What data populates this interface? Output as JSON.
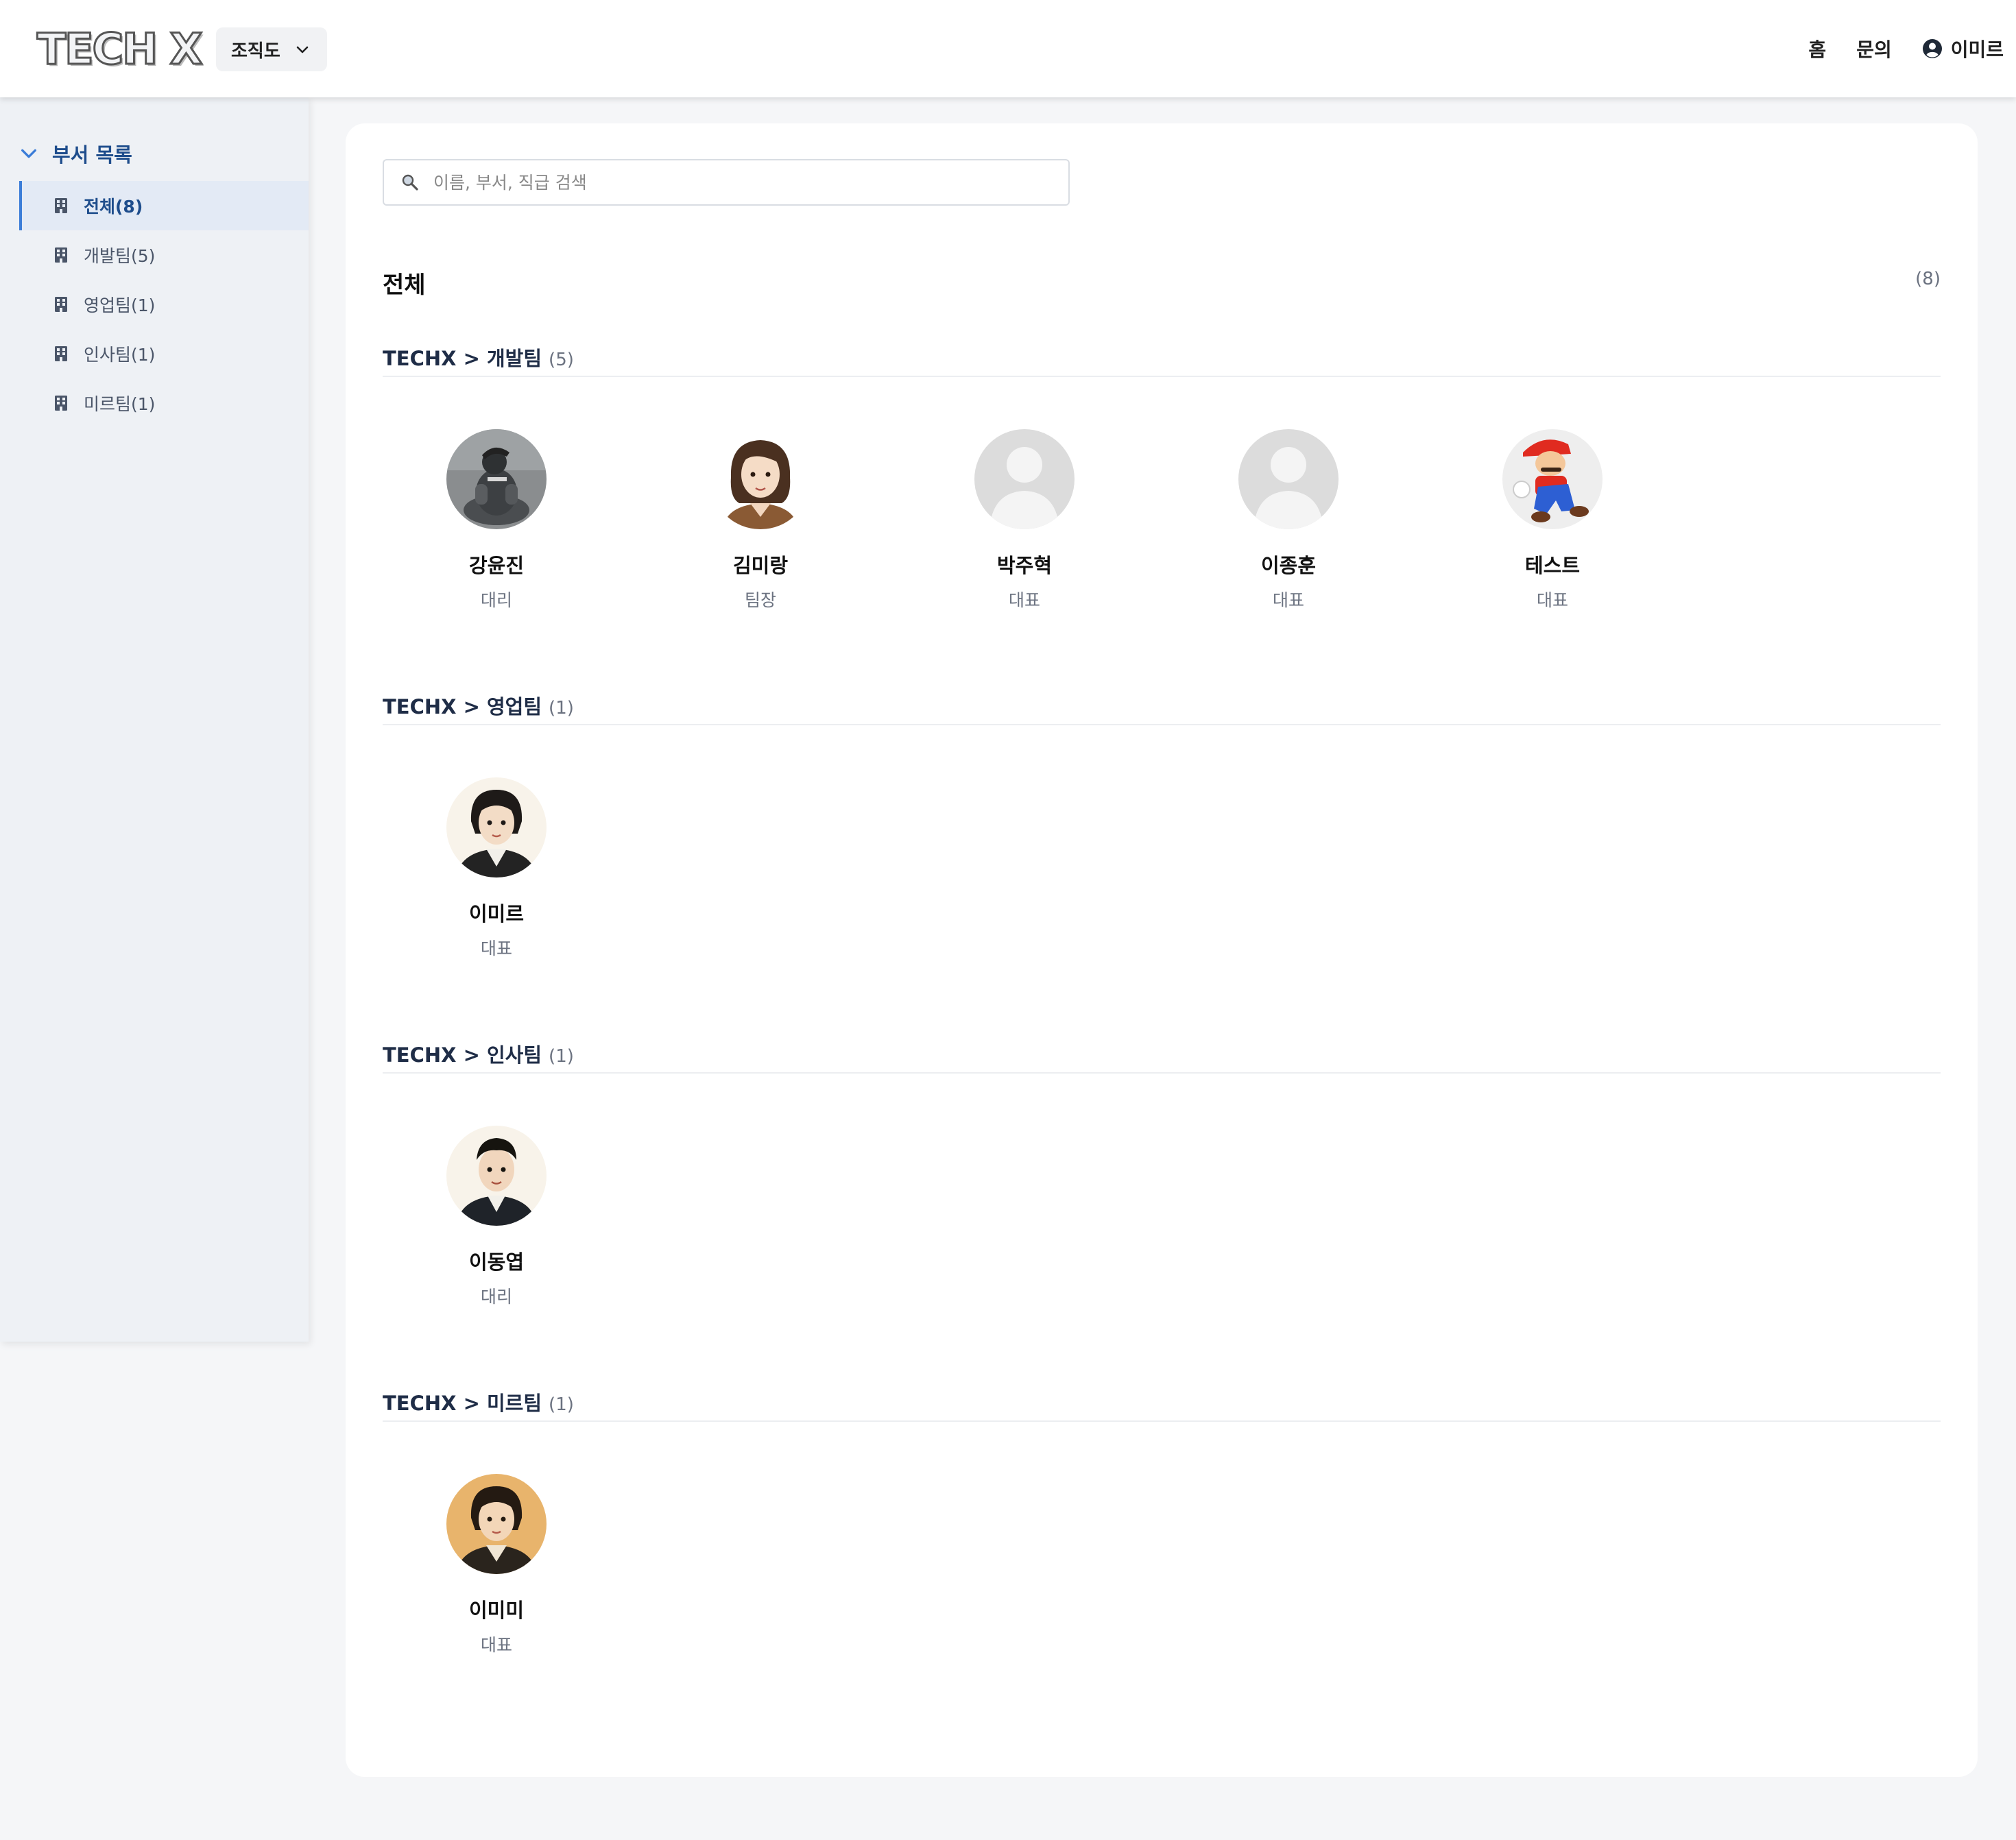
{
  "header": {
    "logo_text": "TECH X",
    "org_select": "조직도",
    "nav": {
      "home": "홈",
      "inquiry": "문의",
      "user": "이미르"
    }
  },
  "sidebar": {
    "title": "부서 목록",
    "items": [
      {
        "label": "전체(8)",
        "active": true
      },
      {
        "label": "개발팀(5)",
        "active": false
      },
      {
        "label": "영업팀(1)",
        "active": false
      },
      {
        "label": "인사팀(1)",
        "active": false
      },
      {
        "label": "미르팀(1)",
        "active": false
      }
    ]
  },
  "main": {
    "search_placeholder": "이름, 부서, 직급 검색",
    "section_title": "전체",
    "section_count": "(8)",
    "groups": [
      {
        "title": "TECHX > 개발팀",
        "count": "(5)",
        "members": [
          {
            "name": "강윤진",
            "role": "대리",
            "avatar": "statue-photo"
          },
          {
            "name": "김미랑",
            "role": "팀장",
            "avatar": "illustrated-woman-short-hair"
          },
          {
            "name": "박주혁",
            "role": "대표",
            "avatar": "default-avatar"
          },
          {
            "name": "이종훈",
            "role": "대표",
            "avatar": "default-avatar"
          },
          {
            "name": "테스트",
            "role": "대표",
            "avatar": "mario-character"
          }
        ]
      },
      {
        "title": "TECHX > 영업팀",
        "count": "(1)",
        "members": [
          {
            "name": "이미르",
            "role": "대표",
            "avatar": "illustrated-woman-bob"
          }
        ]
      },
      {
        "title": "TECHX > 인사팀",
        "count": "(1)",
        "members": [
          {
            "name": "이동엽",
            "role": "대리",
            "avatar": "illustrated-man"
          }
        ]
      },
      {
        "title": "TECHX > 미르팀",
        "count": "(1)",
        "members": [
          {
            "name": "이미미",
            "role": "대표",
            "avatar": "illustrated-woman-warm-bg"
          }
        ]
      }
    ]
  },
  "colors": {
    "accent": "#3b7dd8",
    "sidebar_title": "#1e4d8c",
    "background": "#f5f6f8"
  }
}
